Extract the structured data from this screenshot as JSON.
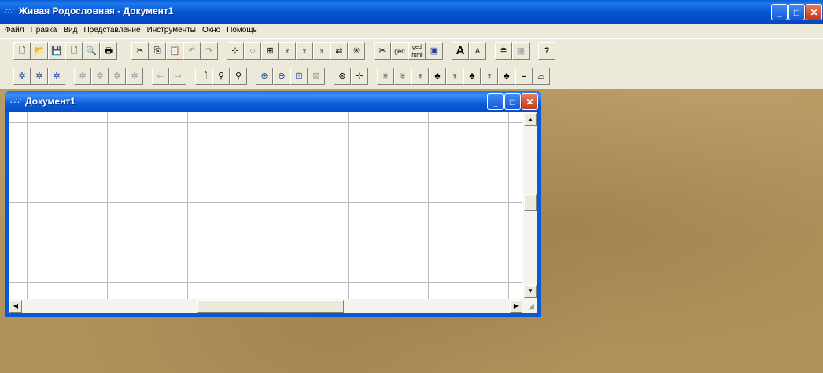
{
  "app": {
    "title": "Живая Родословная - Документ1",
    "icon": "dots-app-icon",
    "colors": {
      "titlebar": "#0553d2",
      "workspace": "#b0935c",
      "close": "#c1391d"
    }
  },
  "window_controls": {
    "minimize": "_",
    "maximize": "□",
    "close": "✕"
  },
  "menu": [
    "Файл",
    "Правка",
    "Вид",
    "Представление",
    "Инструменты",
    "Окно",
    "Помощь"
  ],
  "toolbar1": {
    "new": "🗋",
    "open": "📂",
    "save": "💾",
    "blank": "🗋",
    "preview": "🔍",
    "print": "🖶",
    "cut": "✂",
    "copy": "⎘",
    "paste": "📋",
    "undo": "↶",
    "redo": "↷",
    "t1": "⊹",
    "t2": "◌",
    "t3": "⊞",
    "t4": "♆",
    "t5": "♆",
    "t6": "♆",
    "t7": "⇄",
    "t8": "✳",
    "tools": "✂",
    "ged": "ged",
    "ged_html": "ged html",
    "ged_img": "▣",
    "font_big": "A",
    "font_small": "A",
    "layers": "≘",
    "grid": "▦",
    "help": "?"
  },
  "toolbar2": {
    "b1": "✲",
    "b2": "✲",
    "b3": "✲",
    "b4": "✲",
    "b5": "✲",
    "b6": "✲",
    "b7": "✲",
    "back": "⇐",
    "fwd": "⇒",
    "page": "🗋",
    "find": "⚲",
    "find2": "⚲",
    "zoom_in": "⊕",
    "zoom_out": "⊖",
    "zoom_fit": "⊡",
    "zoom_sel": "⊠",
    "c1": "⊛",
    "c2": "⊹",
    "v1": "♅",
    "v2": "♅",
    "v3": "♆",
    "v4": "♣",
    "v5": "♆",
    "v6": "♣",
    "v7": "♆",
    "v8": "♣",
    "v9": "⌣",
    "v10": "⌓"
  },
  "child_window": {
    "title": "Документ1",
    "icon": "dots-doc-icon",
    "minimize": "_",
    "maximize": "□",
    "close": "✕"
  },
  "scroll": {
    "up": "▲",
    "down": "▼",
    "left": "◀",
    "right": "▶"
  }
}
